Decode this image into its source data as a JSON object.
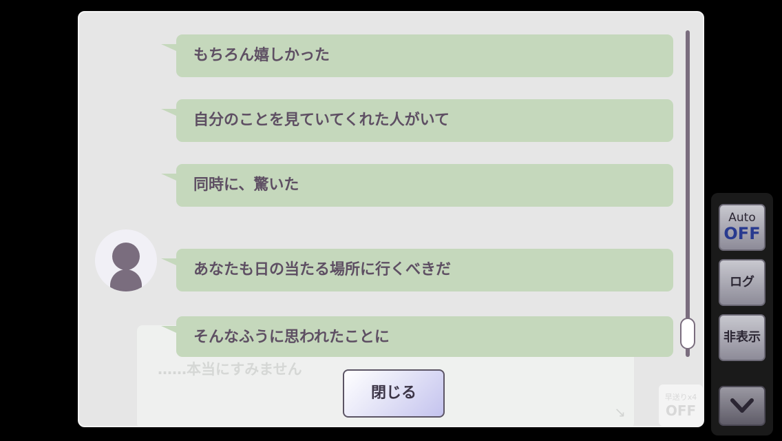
{
  "log": {
    "messages": [
      {
        "text": "もちろん嬉しかった"
      },
      {
        "text": "自分のことを見ていてくれた人がいて"
      },
      {
        "text": "同時に、驚いた"
      },
      {
        "text": "あなたも日の当たる場所に行くべきだ"
      },
      {
        "text": "そんなふうに思われたことに"
      }
    ],
    "close_label": "閉じる"
  },
  "dialog_background": {
    "text": "……本当にすみません",
    "skip_label": "早送りx4",
    "skip_state": "OFF"
  },
  "side_menu": {
    "auto_label": "Auto",
    "auto_state": "OFF",
    "log_label": "ログ",
    "hide_label": "非表示",
    "down_icon": "chevron-down-icon"
  },
  "colors": {
    "bubble": "#c5d8bc",
    "text": "#5e4f63",
    "panel": "#e6e6e6",
    "auto_off": "#283a8f"
  }
}
